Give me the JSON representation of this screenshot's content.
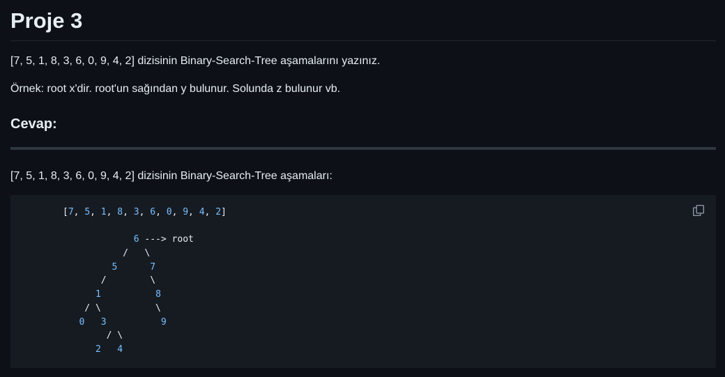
{
  "page": {
    "title": "Proje 3",
    "paragraph_task": "[7, 5, 1, 8, 3, 6, 0, 9, 4, 2] dizisinin Binary-Search-Tree aşamalarını yazınız.",
    "paragraph_example": "Örnek: root x'dir. root'un sağından y bulunur. Solunda z bulunur vb.",
    "answer_heading": "Cevap:",
    "answer_intro": "[7, 5, 1, 8, 3, 6, 0, 9, 4, 2] dizisinin Binary-Search-Tree aşamaları:"
  },
  "code_block": {
    "copy_icon": "copy-icon",
    "lines": [
      "[7, 5, 1, 8, 3, 6, 0, 9, 4, 2]",
      "",
      "             6 ---> root",
      "           /   \\",
      "         5      7",
      "       /        \\",
      "      1          8",
      "    / \\          \\",
      "   0   3          9",
      "        / \\",
      "      2   4"
    ]
  },
  "colors": {
    "background": "#0d1117",
    "code_background": "#161b22",
    "text": "#e6edf3",
    "number": "#79c0ff",
    "rule": "#30363d"
  }
}
